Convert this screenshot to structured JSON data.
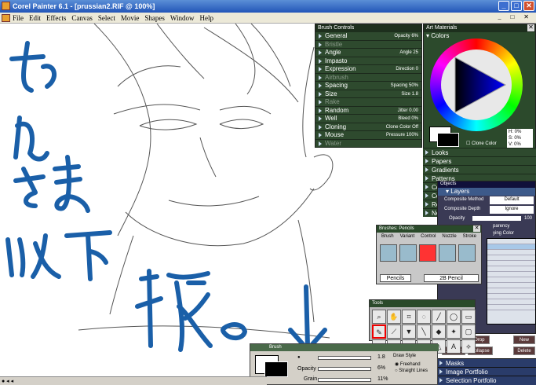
{
  "app": {
    "title": "Corel Painter 6.1 - [prussian2.RIF @ 100%]"
  },
  "menu": [
    "File",
    "Edit",
    "Effects",
    "Canvas",
    "Select",
    "Movie",
    "Shapes",
    "Window",
    "Help"
  ],
  "brush_controls": {
    "title": "Brush Controls",
    "rows": [
      {
        "label": "General",
        "value": "Opacity 6%",
        "enabled": true
      },
      {
        "label": "Bristle",
        "value": "",
        "enabled": false
      },
      {
        "label": "Angle",
        "value": "Angle 25",
        "enabled": true
      },
      {
        "label": "Impasto",
        "value": "",
        "enabled": true
      },
      {
        "label": "Expression",
        "value": "Direction 0",
        "enabled": true
      },
      {
        "label": "Airbrush",
        "value": "",
        "enabled": false
      },
      {
        "label": "Spacing",
        "value": "Spacing 50%",
        "enabled": true
      },
      {
        "label": "Size",
        "value": "Size 1.8",
        "enabled": true
      },
      {
        "label": "Rake",
        "value": "",
        "enabled": false
      },
      {
        "label": "Random",
        "value": "Jitter 0.00",
        "enabled": true
      },
      {
        "label": "Well",
        "value": "Bleed 0%",
        "enabled": true
      },
      {
        "label": "Cloning",
        "value": "Clone Color Off",
        "enabled": true
      },
      {
        "label": "Mouse",
        "value": "Pressure 100%",
        "enabled": true
      },
      {
        "label": "Water",
        "value": "",
        "enabled": false
      }
    ]
  },
  "art_materials": {
    "title": "Art Materials",
    "colors_label": "Colors",
    "hsv": {
      "h": "H: 0%",
      "s": "S: 0%",
      "v": "V: 0%"
    },
    "clone_color": "Clone Color",
    "sections": [
      "Looks",
      "Papers",
      "Gradients",
      "Patterns",
      "Co",
      "Co",
      "Re",
      "Ne"
    ]
  },
  "objects": {
    "title": "Objects",
    "layers_label": "Layers",
    "composite_method_label": "Composite Method",
    "composite_method_value": "Default",
    "composite_depth_label": "Composite Depth",
    "composite_depth_value": "Ignore",
    "opacity_label": "Opacity",
    "opacity_value": "100",
    "transparency": "parency",
    "underlying": "ying Color",
    "buttons": [
      "Drop",
      "New",
      "Ungroup",
      "Collapse",
      "Delete"
    ],
    "bottom_sections": [
      "Masks",
      "Image Portfolio",
      "Selection Portfolio"
    ]
  },
  "brushes": {
    "title": "Brushes: Pencils",
    "menu": [
      "Brush",
      "Variant",
      "Control",
      "Nozzle",
      "Stroke"
    ],
    "category": "Pencils",
    "variant": "2B Pencil"
  },
  "tools": {
    "title": "Tools",
    "icons": [
      "magnifier",
      "grabber",
      "crop",
      "lasso",
      "pen",
      "shape",
      "rect",
      "brush",
      "dropper",
      "paint-bucket",
      "pencil-alt",
      "transform",
      "clone",
      "eraser",
      "rect-select",
      "oval-select",
      "magic-wand",
      "lasso-select",
      "path",
      "text",
      "shape-select"
    ]
  },
  "property_bar": {
    "brush_label": "Brush",
    "draw_style_label": "Draw Style",
    "freehand": "Freehand",
    "straight_lines": "Straight Lines",
    "opacity_label": "Opacity",
    "opacity_value": "6%",
    "size_value": "1.8",
    "grain_label": "Grain",
    "grain_value": "11%"
  },
  "colors": {
    "panel": "#3a5a3a",
    "ink": "#1a5fa8",
    "titlebar": "#2255b8"
  }
}
